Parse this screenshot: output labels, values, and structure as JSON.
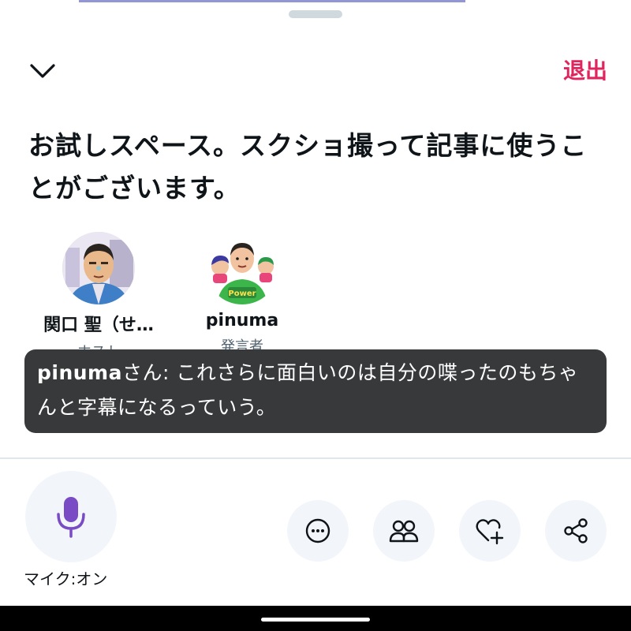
{
  "header": {
    "collapse_icon": "chevron-down-icon",
    "leave_label": "退出",
    "leave_color": "#e0245e"
  },
  "space": {
    "title": "お試しスペース。スクショ撮って記事に使うことがございます。"
  },
  "participants": [
    {
      "name": "関口 聖（せ…",
      "role": "ホスト"
    },
    {
      "name": "pinuma",
      "role": "発言者",
      "badge": "Power"
    }
  ],
  "caption": {
    "user": "pinuma",
    "suffix": "さん: ",
    "text": "これさらに面白いのは自分の喋ったのもちゃんと字幕になるっていう。"
  },
  "controls": {
    "mic_icon": "microphone-icon",
    "mic_label": "マイク:オン",
    "mic_color": "#794bc4",
    "actions": [
      {
        "icon": "more-options-icon"
      },
      {
        "icon": "people-icon"
      },
      {
        "icon": "heart-plus-icon"
      },
      {
        "icon": "share-icon"
      }
    ]
  }
}
